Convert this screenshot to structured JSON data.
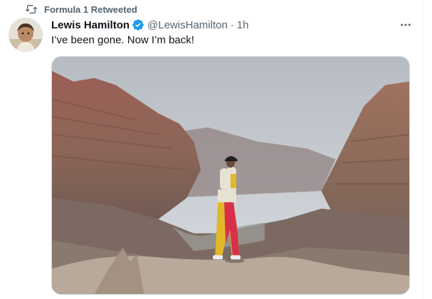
{
  "retweet": {
    "label": "Formula 1 Retweeted",
    "icon": "retweet-icon"
  },
  "tweet": {
    "display_name": "Lewis Hamilton",
    "verified": true,
    "handle": "@LewisHamilton",
    "separator": "·",
    "time": "1h",
    "text": "I’ve been gone. Now I’m back!",
    "media_description": "photo"
  },
  "colors": {
    "text_primary": "#0f1419",
    "text_secondary": "#536471",
    "verified": "#1d9bf0",
    "border": "#cfd9de"
  }
}
